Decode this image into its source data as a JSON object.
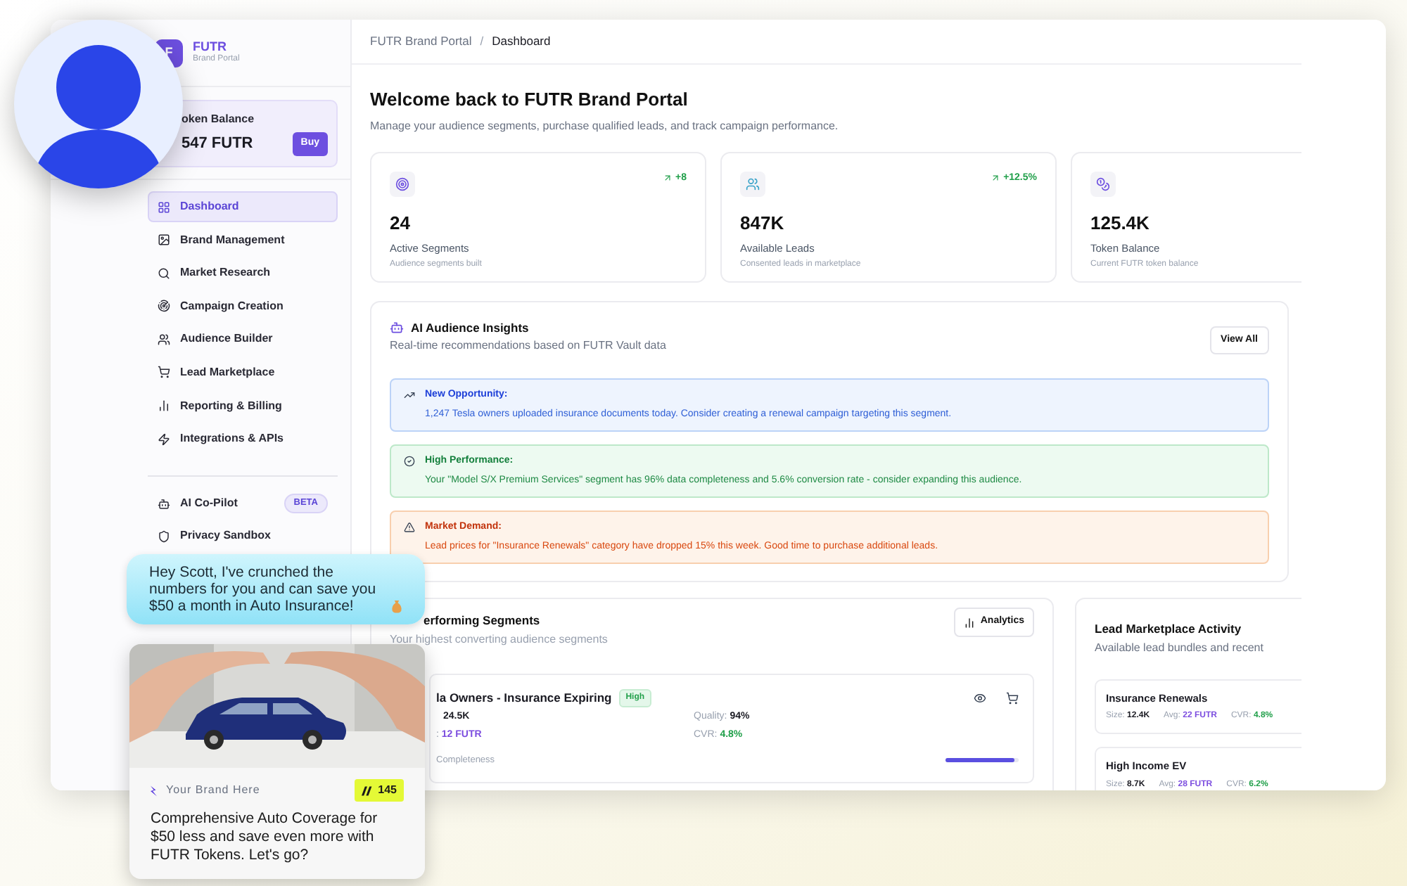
{
  "sidebar": {
    "logo": "F",
    "name": "FUTR",
    "subtitle": "Brand Portal",
    "token_card": {
      "label": "oken Balance",
      "amount": "547 FUTR",
      "button": "Buy"
    },
    "nav": [
      {
        "label": "Dashboard",
        "selected": true
      },
      {
        "label": "Brand Management",
        "selected": false
      },
      {
        "label": "Market Research",
        "selected": false
      },
      {
        "label": "Campaign Creation",
        "selected": false
      },
      {
        "label": "Audience Builder",
        "selected": false
      },
      {
        "label": "Lead Marketplace",
        "selected": false
      },
      {
        "label": "Reporting & Billing",
        "selected": false
      },
      {
        "label": "Integrations & APIs",
        "selected": false
      }
    ],
    "tools": [
      {
        "label": "AI Co-Pilot",
        "badge": "BETA",
        "selected": false
      },
      {
        "label": "Privacy Sandbox",
        "selected": false
      }
    ]
  },
  "breadcrumb": {
    "items": [
      "FUTR Brand Portal",
      "Dashboard"
    ],
    "separator": "/"
  },
  "header": {
    "title": "Welcome back to FUTR Brand Portal",
    "subtitle": "Manage your audience segments, purchase qualified leads, and track campaign performance."
  },
  "stats": [
    {
      "value": "24",
      "label": "Active Segments",
      "caption": "Audience segments built",
      "delta": "+8"
    },
    {
      "value": "847K",
      "label": "Available Leads",
      "caption": "Consented leads in marketplace",
      "delta": "+12.5%"
    },
    {
      "value": "125.4K",
      "label": "Token Balance",
      "caption": "Current FUTR token balance"
    }
  ],
  "insights": {
    "title": "AI Audience Insights",
    "subtitle": "Real-time recommendations based on FUTR Vault data",
    "button": "View All",
    "alerts": [
      {
        "kind": "opportunity",
        "title": "New Opportunity:",
        "text": "1,247 Tesla owners uploaded insurance documents today. Consider creating a renewal campaign targeting this segment."
      },
      {
        "kind": "performance",
        "title": "High Performance:",
        "text": "Your \"Model S/X Premium Services\" segment has 96% data completeness and 5.6% conversion rate - consider expanding this audience."
      },
      {
        "kind": "demand",
        "title": "Market Demand:",
        "text": "Lead prices for \"Insurance Renewals\" category have dropped 15% this week. Good time to purchase additional leads."
      }
    ]
  },
  "segments": {
    "title": "erforming Segments",
    "subtitle": "Your highest converting audience segments",
    "button": "Analytics",
    "rows": [
      {
        "name": "la Owners - Insurance Expiring",
        "badge": "High",
        "size": "24.5K",
        "price_label": ":",
        "price": "12 FUTR",
        "quality_label": "Quality:",
        "quality": "94%",
        "cvr_label": "CVR:",
        "cvr": "4.8%",
        "completeness_label": "Completeness",
        "level": 0.95
      }
    ]
  },
  "marketplace": {
    "title": "Lead Marketplace Activity",
    "subtitle": "Available lead bundles and recent",
    "bundles": [
      {
        "name": "Insurance Renewals",
        "size_label": "Size:",
        "size": "12.4K",
        "avg_label": "Avg:",
        "avg": "22 FUTR",
        "cvr_label": "CVR:",
        "cvr": "4.8%"
      },
      {
        "name": "High Income EV",
        "size_label": "Size:",
        "size": "8.7K",
        "avg_label": "Avg:",
        "avg": "28 FUTR",
        "cvr_label": "CVR:",
        "cvr": "6.2%"
      }
    ]
  },
  "chat_bubble": {
    "text": "Hey Scott, I've crunched the numbers for you and can save you $50 a month in Auto Insurance!"
  },
  "ad_card": {
    "brand": "Your Brand Here",
    "token_badge": "145",
    "text": "Comprehensive Auto Coverage for $50 less and save even more with FUTR Tokens. Let's go?"
  }
}
